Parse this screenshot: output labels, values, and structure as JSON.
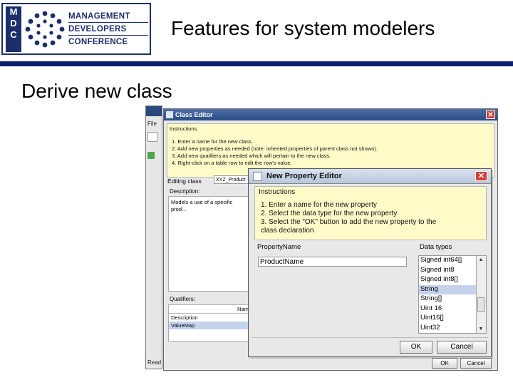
{
  "logo": {
    "letters": [
      "M",
      "D",
      "C"
    ],
    "lines": [
      "MANAGEMENT",
      "DEVELOPERS",
      "CONFERENCE"
    ],
    "brand_color": "#1c2f6b"
  },
  "slide": {
    "title": "Features for system modelers",
    "subtitle": "Derive new class",
    "rule_color": "#0a1f6b"
  },
  "background_app": {
    "menu_fragment": "File",
    "status_fragment": "Read"
  },
  "class_editor": {
    "title": "Class Editor",
    "instructions_label": "Instructions",
    "instructions": [
      "1. Enter a name for the new class.",
      "2. Add new properties as needed (note: inherited properties of parent class not shown).",
      "3. Add new qualifiers as needed which will pertain to the new class.",
      "4. Right-click on a table row to edit the row's value."
    ],
    "editing_class_label": "Editing class",
    "editing_class_value": "XYZ_Product",
    "description_label": "Description:",
    "description_text": "Models a use of a specific prod...",
    "qualifiers_label": "Qualifiers:",
    "qualifiers_column": "Name",
    "qualifiers_rows": [
      "Description",
      "ValueMap"
    ],
    "ok_label": "OK",
    "cancel_label": "Cancel"
  },
  "new_property_editor": {
    "title": "New Property Editor",
    "instructions_label": "Instructions",
    "instructions": [
      "1. Enter a name for the new property",
      "2. Select the data type for the new property",
      "3. Select the \"OK\" button to add the new property to the",
      "class declaration"
    ],
    "property_name_label": "PropertyName",
    "property_name_value": "ProductName",
    "data_types_label": "Data types",
    "data_types": [
      "Signed int64[]",
      "Signed int8",
      "Signed int8[]",
      "String",
      "String[]",
      "Uint 16",
      "Uint16[]",
      "Uint32"
    ],
    "selected_data_type": "String",
    "ok_label": "OK",
    "cancel_label": "Cancel"
  }
}
